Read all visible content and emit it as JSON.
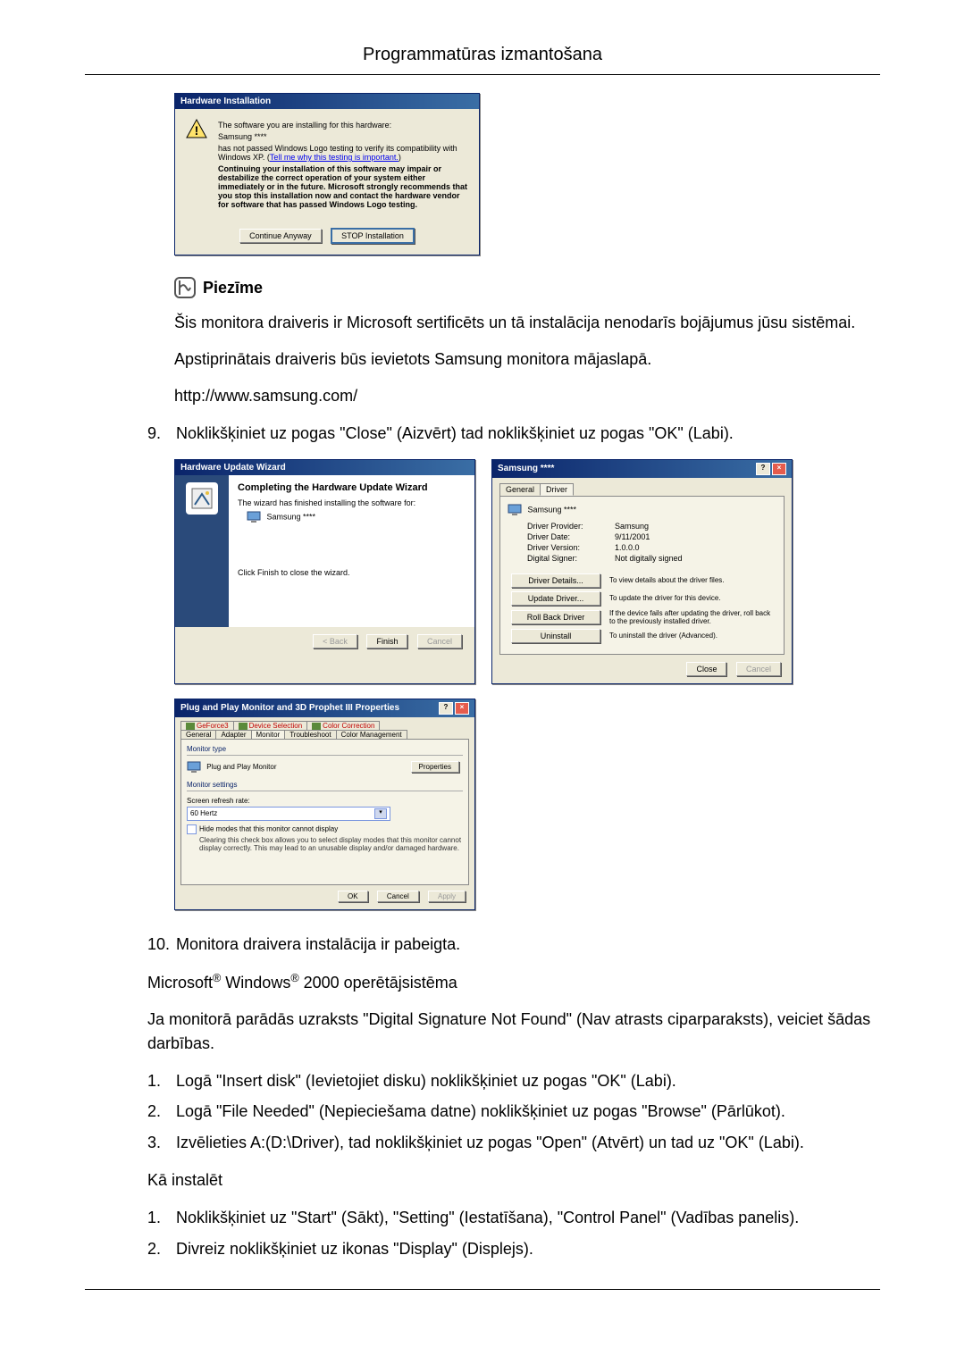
{
  "header": {
    "title": "Programmatūras izmantošana"
  },
  "dlg_hwinst": {
    "title": "Hardware Installation",
    "line1": "The software you are installing for this hardware:",
    "device": "Samsung ****",
    "line2a": "has not passed Windows Logo testing to verify its compatibility with Windows XP. (",
    "link": "Tell me why this testing is important.",
    "line2b": ")",
    "bold": "Continuing your installation of this software may impair or destabilize the correct operation of your system either immediately or in the future. Microsoft strongly recommends that you stop this installation now and contact the hardware vendor for software that has passed Windows Logo testing.",
    "btn_continue": "Continue Anyway",
    "btn_stop": "STOP Installation"
  },
  "note": {
    "label": "Piezīme"
  },
  "paras": {
    "p1": "Šis monitora draiveris ir Microsoft sertificēts un tā instalācija nenodarīs bojājumus jūsu sistēmai.",
    "p2": "Apstiprinātais draiveris būs ievietots Samsung monitora mājaslapā.",
    "p3": "http://www.samsung.com/"
  },
  "step9": {
    "num": "9.",
    "text": "Noklikšķiniet uz pogas \"Close\" (Aizvērt) tad noklikšķiniet uz pogas \"OK\" (Labi)."
  },
  "dlg_wizard": {
    "title": "Hardware Update Wizard",
    "head": "Completing the Hardware Update Wizard",
    "line1": "The wizard has finished installing the software for:",
    "device": "Samsung ****",
    "footer": "Click Finish to close the wizard.",
    "btn_back": "< Back",
    "btn_finish": "Finish",
    "btn_cancel": "Cancel"
  },
  "dlg_props": {
    "title": "Samsung ****",
    "tab_general": "General",
    "tab_driver": "Driver",
    "device": "Samsung ****",
    "rows": {
      "provider_l": "Driver Provider:",
      "provider_v": "Samsung",
      "date_l": "Driver Date:",
      "date_v": "9/11/2001",
      "version_l": "Driver Version:",
      "version_v": "1.0.0.0",
      "signer_l": "Digital Signer:",
      "signer_v": "Not digitally signed"
    },
    "btn_details": "Driver Details...",
    "desc_details": "To view details about the driver files.",
    "btn_update": "Update Driver...",
    "desc_update": "To update the driver for this device.",
    "btn_rollback": "Roll Back Driver",
    "desc_rollback": "If the device fails after updating the driver, roll back to the previously installed driver.",
    "btn_uninstall": "Uninstall",
    "desc_uninstall": "To uninstall the driver (Advanced).",
    "btn_close": "Close",
    "btn_cancel": "Cancel"
  },
  "dlg_pnp": {
    "title": "Plug and Play Monitor and 3D Prophet III Properties",
    "tabs_top": {
      "t1": "GeForce3",
      "t2": "Device Selection",
      "t3": "Color Correction"
    },
    "tabs_bot": {
      "t1": "General",
      "t2": "Adapter",
      "t3": "Monitor",
      "t4": "Troubleshoot",
      "t5": "Color Management"
    },
    "sect_type": "Monitor type",
    "mon_name": "Plug and Play Monitor",
    "btn_props": "Properties",
    "sect_settings": "Monitor settings",
    "lbl_refresh": "Screen refresh rate:",
    "refresh_val": "60 Hertz",
    "chk_hide": "Hide modes that this monitor cannot display",
    "hide_desc": "Clearing this check box allows you to select display modes that this monitor cannot display correctly. This may lead to an unusable display and/or damaged hardware.",
    "btn_ok": "OK",
    "btn_cancel": "Cancel",
    "btn_apply": "Apply"
  },
  "step10": {
    "num": "10.",
    "text": "Monitora draivera instalācija ir pabeigta."
  },
  "win2000": {
    "line": {
      "a": "Microsoft",
      "r": "®",
      "b": " Windows",
      "c": " 2000 operētājsistēma"
    },
    "p": "Ja monitorā parādās uzraksts \"Digital Signature Not Found\" (Nav atrasts ciparparaksts), veiciet šādas darbības.",
    "s1n": "1.",
    "s1": "Logā \"Insert disk\" (Ievietojiet disku) noklikšķiniet uz pogas \"OK\" (Labi).",
    "s2n": "2.",
    "s2": "Logā \"File Needed\" (Nepieciešama datne) noklikšķiniet uz pogas \"Browse\" (Pārlūkot).",
    "s3n": "3.",
    "s3": "Izvēlieties A:(D:\\Driver), tad noklikšķiniet uz pogas \"Open\" (Atvērt) un tad uz \"OK\" (Labi).",
    "how": "Kā instalēt",
    "h1n": "1.",
    "h1": "Noklikšķiniet uz \"Start\" (Sākt), \"Setting\" (Iestatīšana), \"Control Panel\" (Vadības panelis).",
    "h2n": "2.",
    "h2": "Divreiz noklikšķiniet uz ikonas \"Display\" (Displejs)."
  }
}
